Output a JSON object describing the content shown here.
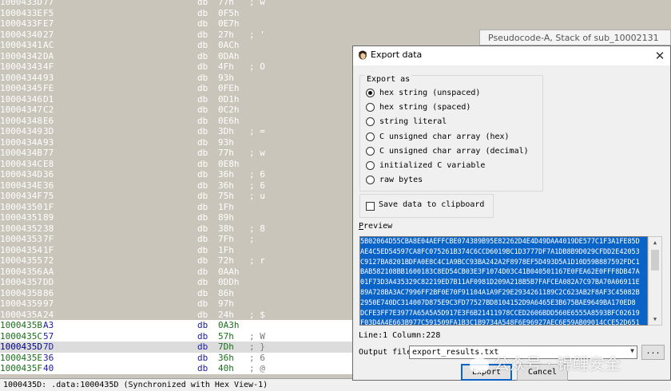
{
  "listing": {
    "rows": [
      {
        "addr": "1000433D",
        "byte": "77",
        "val": "77h",
        "cmt": "; w",
        "style": "sel"
      },
      {
        "addr": "1000433E",
        "byte": "F5",
        "val": "0F5h",
        "cmt": "",
        "style": "sel"
      },
      {
        "addr": "1000433F",
        "byte": "E7",
        "val": "0E7h",
        "cmt": "",
        "style": "sel"
      },
      {
        "addr": "10004340",
        "byte": "27",
        "val": "27h",
        "cmt": "; '",
        "style": "sel"
      },
      {
        "addr": "10004341",
        "byte": "AC",
        "val": "0ACh",
        "cmt": "",
        "style": "sel"
      },
      {
        "addr": "10004342",
        "byte": "DA",
        "val": "0DAh",
        "cmt": "",
        "style": "sel"
      },
      {
        "addr": "10004343",
        "byte": "4F",
        "val": "4Fh",
        "cmt": "; O",
        "style": "sel"
      },
      {
        "addr": "10004344",
        "byte": "93",
        "val": "93h",
        "cmt": "",
        "style": "sel"
      },
      {
        "addr": "10004345",
        "byte": "FE",
        "val": "0FEh",
        "cmt": "",
        "style": "sel"
      },
      {
        "addr": "10004346",
        "byte": "D1",
        "val": "0D1h",
        "cmt": "",
        "style": "sel"
      },
      {
        "addr": "10004347",
        "byte": "C2",
        "val": "0C2h",
        "cmt": "",
        "style": "sel"
      },
      {
        "addr": "10004348",
        "byte": "E6",
        "val": "0E6h",
        "cmt": "",
        "style": "sel"
      },
      {
        "addr": "10004349",
        "byte": "3D",
        "val": "3Dh",
        "cmt": "; =",
        "style": "sel"
      },
      {
        "addr": "1000434A",
        "byte": "93",
        "val": "93h",
        "cmt": "",
        "style": "sel"
      },
      {
        "addr": "1000434B",
        "byte": "77",
        "val": "77h",
        "cmt": "; w",
        "style": "sel"
      },
      {
        "addr": "1000434C",
        "byte": "E8",
        "val": "0E8h",
        "cmt": "",
        "style": "sel"
      },
      {
        "addr": "1000434D",
        "byte": "36",
        "val": "36h",
        "cmt": "; 6",
        "style": "sel"
      },
      {
        "addr": "1000434E",
        "byte": "36",
        "val": "36h",
        "cmt": "; 6",
        "style": "sel"
      },
      {
        "addr": "1000434F",
        "byte": "75",
        "val": "75h",
        "cmt": "; u",
        "style": "sel"
      },
      {
        "addr": "10004350",
        "byte": "1F",
        "val": "1Fh",
        "cmt": "",
        "style": "sel"
      },
      {
        "addr": "10004351",
        "byte": "89",
        "val": "89h",
        "cmt": "",
        "style": "sel"
      },
      {
        "addr": "10004352",
        "byte": "38",
        "val": "38h",
        "cmt": "; 8",
        "style": "sel"
      },
      {
        "addr": "10004353",
        "byte": "7F",
        "val": "7Fh",
        "cmt": ";",
        "style": "sel"
      },
      {
        "addr": "10004354",
        "byte": "1F",
        "val": "1Fh",
        "cmt": "",
        "style": "sel"
      },
      {
        "addr": "10004355",
        "byte": "72",
        "val": "72h",
        "cmt": "; r",
        "style": "sel"
      },
      {
        "addr": "10004356",
        "byte": "AA",
        "val": "0AAh",
        "cmt": "",
        "style": "sel"
      },
      {
        "addr": "10004357",
        "byte": "DD",
        "val": "0DDh",
        "cmt": "",
        "style": "sel"
      },
      {
        "addr": "10004358",
        "byte": "86",
        "val": "86h",
        "cmt": "",
        "style": "sel"
      },
      {
        "addr": "10004359",
        "byte": "97",
        "val": "97h",
        "cmt": "",
        "style": "sel"
      },
      {
        "addr": "1000435A",
        "byte": "24",
        "val": "24h",
        "cmt": "; $",
        "style": "sel"
      },
      {
        "addr": "1000435B",
        "byte": "A3",
        "val": "0A3h",
        "cmt": "",
        "style": "normal"
      },
      {
        "addr": "1000435C",
        "byte": "57",
        "val": "57h",
        "cmt": "; W",
        "style": "normal"
      },
      {
        "addr": "1000435D",
        "byte": "7D",
        "val": "7Dh",
        "cmt": "; }",
        "style": "current"
      },
      {
        "addr": "1000435E",
        "byte": "36",
        "val": "36h",
        "cmt": "; 6",
        "style": "normal"
      },
      {
        "addr": "1000435F",
        "byte": "40",
        "val": "40h",
        "cmt": "; @",
        "style": "normal"
      }
    ],
    "db_keyword": "db"
  },
  "statusbar": {
    "text": "1000435D: .data:1000435D (Synchronized with Hex View-1)"
  },
  "pseudo_tab": {
    "label": "Pseudocode-A, Stack of sub_10002131"
  },
  "dialog": {
    "title": "Export data",
    "close_glyph": "✕",
    "export_as_label": "Export as",
    "options": [
      {
        "label": "hex string (unspaced)",
        "selected": true
      },
      {
        "label": "hex string (spaced)",
        "selected": false
      },
      {
        "label": "string literal",
        "selected": false
      },
      {
        "label": "C unsigned char array (hex)",
        "selected": false
      },
      {
        "label": "C unsigned char array (decimal)",
        "selected": false
      },
      {
        "label": "initialized C variable",
        "selected": false
      },
      {
        "label": "raw bytes",
        "selected": false
      }
    ],
    "clipboard_label": "Save data to clipboard",
    "preview_label_first": "P",
    "preview_label_rest": "review",
    "preview_lines": [
      "5B02064D55CBA8E04AEFFCBE074389B95E82262D4E4D49DAA4019DE577C1F3A1FE85D",
      "AE4C5ED54597CA8FC075261B374C6CCD6019BC1D3777DF7A1DB8B9D029CFDD2E42053",
      "C9127BA8201BDFA0E8C4C1A9BCC93BA242A2F8978EF5D493D5A1D10D59B887592FDC1",
      "BAB582108BB1600183C8ED54CB03E3F1074D03C41B040501167E0FEA62E0FFF8DB47A",
      "01F73D3A435329C82219ED7B11AF0981D209A218B5B7FAFCEA082A7C97BA70A06911E",
      "89A728BA3AC7996FF2BF0E70F91104A1A9F29E2934261189C2C623AB2F8AF3C45082B",
      "2950E740DC314007D875E9C3FD77527BD8104152D9A6465E3B675BAE9649BA170ED8",
      "DCFE3FF7E3977A65A5A5D917E3F6B21411978CCED2606BDD560E6555A8593BFC02619",
      "F03D4A4E663B977C591509FA1B3C1B9734A548F6E96927AEC6E59AB09014CCE52D651"
    ],
    "line_col": "Line:1  Column:228",
    "output_file_label": "Output file",
    "output_file_value": "export_results.txt",
    "combo_arrow": "▼",
    "browse_label": "...",
    "export_label": "Export",
    "cancel_label": "Cancel"
  },
  "watermark": {
    "text": "公众号 · 锦鲤安全"
  }
}
